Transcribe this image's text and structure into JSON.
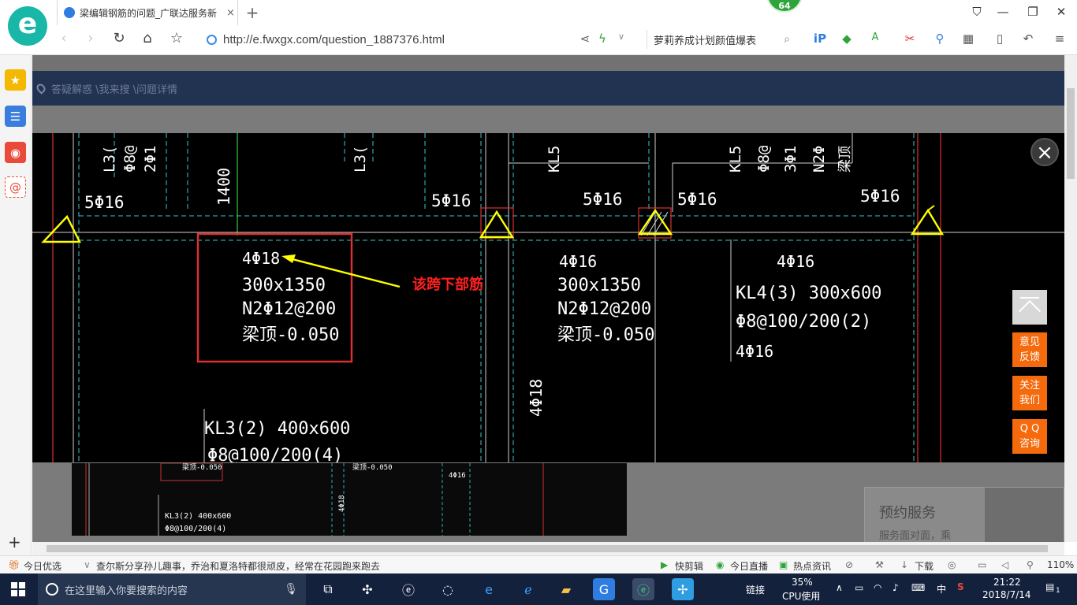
{
  "browser": {
    "logo_letter": "e",
    "tab_title": "梁编辑钢筋的问题_广联达服务新",
    "tab_close": "×",
    "new_tab": "+",
    "badge": "64",
    "url": "http://e.fwxgx.com/question_1887376.html",
    "search_text": "萝莉养成计划颜值爆表",
    "win_controls": [
      "⛉",
      "—",
      "❐",
      "✕"
    ]
  },
  "page": {
    "breadcrumb": "答疑解惑 \\我来搜 \\问题详情",
    "close_label": "×",
    "totop_label": "",
    "side_buttons": [
      {
        "line1": "意见",
        "line2": "反馈"
      },
      {
        "line1": "关注",
        "line2": "我们"
      },
      {
        "line1": "Q Q",
        "line2": "咨询"
      }
    ],
    "reserve_title": "预约服务",
    "reserve_sub": "服务面对面，乘"
  },
  "cad": {
    "top_rebar": [
      "5Φ16",
      "5Φ16",
      "5Φ16",
      "5Φ16",
      "5Φ16"
    ],
    "dim_1400": "1400",
    "box_lines": [
      "4Φ18",
      "300x1350",
      "N2Φ12@200",
      "梁顶-0.050"
    ],
    "mid_lines": [
      "4Φ16",
      "300x1350",
      "N2Φ12@200",
      "梁顶-0.050"
    ],
    "right_lines": [
      "4Φ16",
      "KL4(3) 300x600",
      "Φ8@100/200(2)",
      "4Φ16"
    ],
    "bottom_lines": [
      "KL3(2) 400x600",
      "Φ8@100/200(4)"
    ],
    "vertical_4phi18": "4Φ18",
    "annotation": "该跨下部筋",
    "top_labels": [
      "L3(",
      "Φ8@",
      "2Φ1",
      "L3(",
      "KL5",
      "KL5",
      "Φ8@",
      "3Φ1",
      "N2Φ",
      "梁顶"
    ],
    "bg_labels": [
      "梁顶-0.050",
      "梁顶-0.050",
      "4Φ16",
      "4Φ18",
      "KL3(2) 400x600",
      "Φ8@100/200(4)"
    ]
  },
  "statusbar": {
    "today": "今日优选",
    "news": "查尔斯分享孙儿趣事，乔治和夏洛特都很顽皮，经常在花园跑来跑去",
    "kuaijianji": "快剪辑",
    "live": "今日直播",
    "hot": "热点资讯",
    "download": "下载",
    "zoom": "110%"
  },
  "taskbar": {
    "search_placeholder": "在这里输入你要搜索的内容",
    "link": "链接",
    "cpu_percent": "35%",
    "cpu_label": "CPU使用",
    "ime": "中",
    "time": "21:22",
    "date": "2018/7/14",
    "notif_count": "1"
  }
}
